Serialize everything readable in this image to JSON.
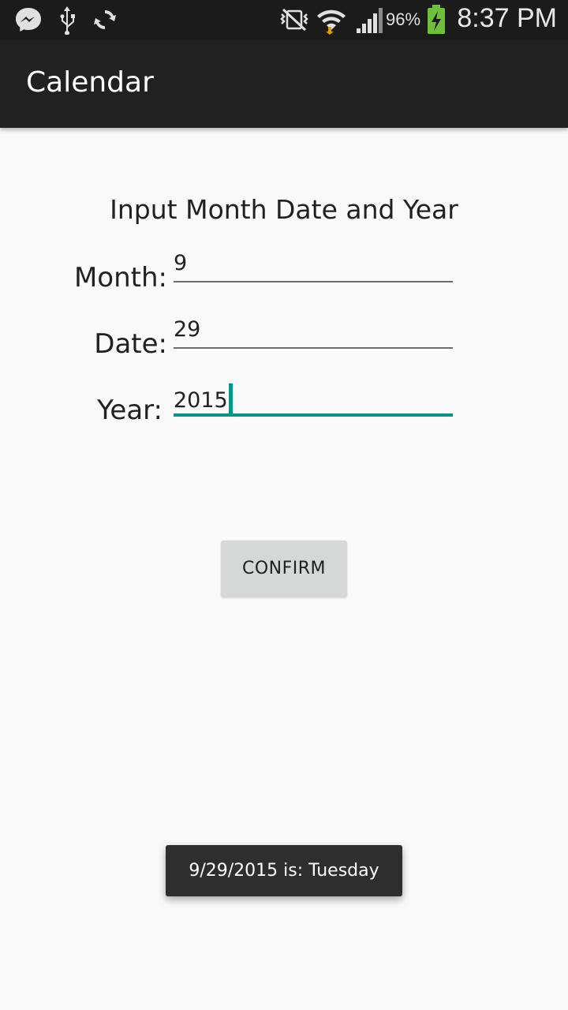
{
  "status_bar": {
    "time": "8:37 PM",
    "battery_percent": "96%",
    "icons": [
      "messenger-icon",
      "usb-icon",
      "sync-icon",
      "nfc-muted-icon",
      "wifi-icon",
      "signal-icon",
      "battery-charging-icon"
    ]
  },
  "app_bar": {
    "title": "Calendar"
  },
  "form": {
    "heading": "Input Month Date and Year",
    "month": {
      "label": "Month:",
      "value": "9"
    },
    "date": {
      "label": "Date:",
      "value": "29"
    },
    "year": {
      "label": "Year:",
      "value": "2015"
    }
  },
  "confirm_button": {
    "label": "CONFIRM"
  },
  "toast": {
    "message": "9/29/2015 is: Tuesday"
  },
  "colors": {
    "accent": "#009688",
    "app_bar": "#212121",
    "status_bar": "#1b1b1b",
    "background": "#fafafa"
  }
}
